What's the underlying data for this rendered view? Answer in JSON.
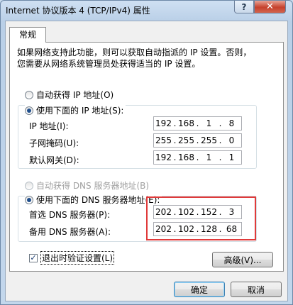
{
  "window": {
    "title": "Internet 协议版本 4 (TCP/IPv4) 属性"
  },
  "titlebar": {
    "help_label": "?",
    "close_label": "✕"
  },
  "tabs": [
    {
      "label": "常规"
    }
  ],
  "description": {
    "line1": "如果网络支持此功能，则可以获取自动指派的 IP 设置。否则，",
    "line2": "您需要从网络系统管理员处获得适当的 IP 设置。"
  },
  "ip_section": {
    "auto_label": "自动获得 IP 地址(O)",
    "manual_label": "使用下面的 IP 地址(S):",
    "selected": "manual",
    "fields": [
      {
        "label": "IP 地址(I):",
        "octets": [
          "192",
          "168",
          "1",
          "8"
        ]
      },
      {
        "label": "子网掩码(U):",
        "octets": [
          "255",
          "255",
          "255",
          "0"
        ]
      },
      {
        "label": "默认网关(D):",
        "octets": [
          "192",
          "168",
          "1",
          "1"
        ]
      }
    ]
  },
  "dns_section": {
    "auto_label": "自动获得 DNS 服务器地址(B)",
    "manual_label": "使用下面的 DNS 服务器地址(E):",
    "selected": "manual",
    "fields": [
      {
        "label": "首选 DNS 服务器(P):",
        "octets": [
          "202",
          "102",
          "152",
          "3"
        ]
      },
      {
        "label": "备用 DNS 服务器(A):",
        "octets": [
          "202",
          "102",
          "128",
          "68"
        ]
      }
    ]
  },
  "validate_checkbox": {
    "label": "退出时验证设置(L)",
    "checked": true
  },
  "buttons": {
    "advanced": "高级(V)...",
    "ok": "确定",
    "cancel": "取消"
  },
  "colors": {
    "highlight_box": "#e03a3a",
    "accent": "#1f4e8c"
  }
}
